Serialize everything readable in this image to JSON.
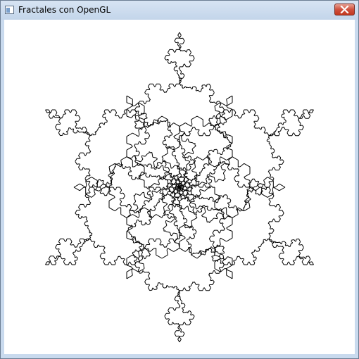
{
  "window": {
    "title": "Fractales con OpenGL",
    "icon": "application-window-icon",
    "close_icon": "close-x-icon"
  },
  "canvas": {
    "background": "#ffffff",
    "stroke_color": "#000000",
    "content": "fractal-line-drawing"
  },
  "colors": {
    "titlebar": "#c9daee",
    "close_button": "#c8412c"
  }
}
